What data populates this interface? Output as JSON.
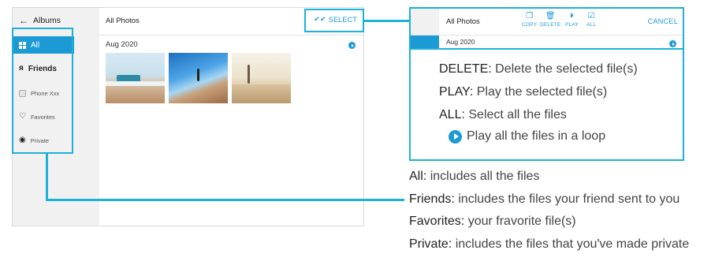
{
  "app": {
    "back_icon": "arrow-left-icon",
    "albums_label": "Albums",
    "sidebar": [
      {
        "label": "All",
        "icon": "grid-icon",
        "active": true
      },
      {
        "label": "Friends",
        "icon": "people-icon"
      },
      {
        "label": "Phone Xxx",
        "icon": "phone-icon"
      },
      {
        "label": "Favorites",
        "icon": "heart-icon"
      },
      {
        "label": "Private",
        "icon": "eye-icon"
      }
    ],
    "content_title": "All Photos",
    "select_label": "SELECT",
    "date_group": "Aug 2020",
    "photo_count": 3
  },
  "toolbar_zoom": {
    "title": "All Photos",
    "tools": [
      {
        "label": "COPY",
        "icon": "copy-icon"
      },
      {
        "label": "DELETE",
        "icon": "trash-icon"
      },
      {
        "label": "PLAY",
        "icon": "play-icon"
      },
      {
        "label": "ALL",
        "icon": "checkbox-icon"
      }
    ],
    "cancel_label": "CANCEL",
    "date_group": "Aug 2020"
  },
  "descriptions": [
    {
      "term": "DELETE:",
      "text": "Delete the selected file(s)"
    },
    {
      "term": "PLAY:",
      "text": "Play the selected file(s)"
    },
    {
      "term": "ALL:",
      "text": "Select all the files"
    },
    {
      "term": "",
      "text": "Play all the files in a loop"
    }
  ],
  "album_legend": [
    {
      "term": "All:",
      "text": "includes all the files"
    },
    {
      "term": "Friends:",
      "text": "includes the files your friend sent to you"
    },
    {
      "term": "Favorites:",
      "text": "your fravorite file(s)"
    },
    {
      "term": "Private:",
      "text": "includes the files that you've made private"
    }
  ],
  "colors": {
    "accent": "#1b9ad6",
    "callout": "#1db1d8"
  }
}
